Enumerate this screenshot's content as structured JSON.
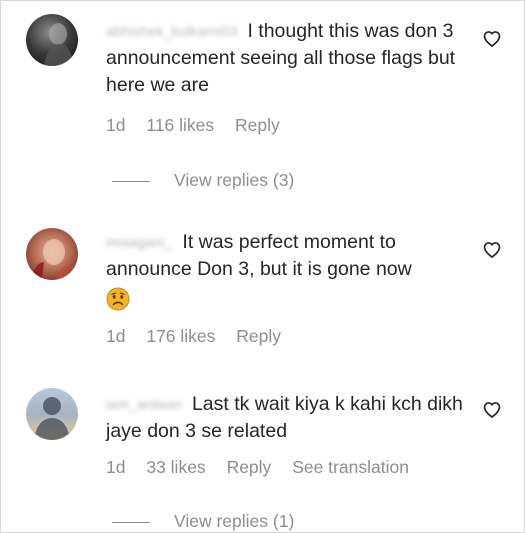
{
  "comments": [
    {
      "username": "abhishek_kulkarni03",
      "text": "I thought this was don 3 announcement seeing all those flags but here we are",
      "time": "1d",
      "likes": "116 likes",
      "reply_label": "Reply",
      "view_replies": "View replies (3)",
      "avatar_icon": "avatar-icon"
    },
    {
      "username": "imaagani_",
      "text": "It was perfect moment to announce Don 3, but it is gone now",
      "emoji": "sad-face-emoji",
      "time": "1d",
      "likes": "176 likes",
      "reply_label": "Reply",
      "avatar_icon": "avatar-icon"
    },
    {
      "username": "iam_ardaan",
      "text": "Last tk wait kiya k kahi kch dikh jaye don 3 se related",
      "time": "1d",
      "likes": "33 likes",
      "reply_label": "Reply",
      "translate_label": "See translation",
      "view_replies": "View replies (1)",
      "avatar_icon": "avatar-icon"
    }
  ],
  "icons": {
    "like": "heart-icon"
  },
  "colors": {
    "text": "#262626",
    "muted": "#8e8e8e",
    "border": "#d7d7d7"
  }
}
